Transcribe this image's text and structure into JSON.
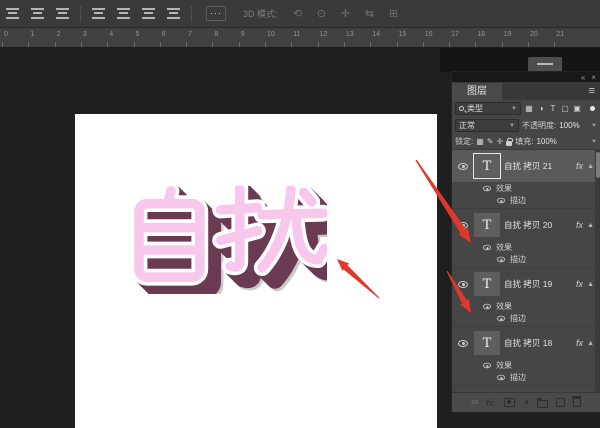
{
  "options_bar": {
    "align_icons_group1": [
      "align-top-edges-icon",
      "align-vertical-centers-icon",
      "align-bottom-edges-icon"
    ],
    "align_icons_group2": [
      "distribute-top-icon",
      "distribute-vertical-centers-icon",
      "distribute-bottom-icon",
      "distribute-spacing-icon"
    ],
    "more_label": "···",
    "mode_label": "3D 模式:",
    "mode_icons": [
      "3d-rotate-icon",
      "3d-roll-icon",
      "3d-drag-icon",
      "3d-slide-icon",
      "3d-scale-icon"
    ]
  },
  "ruler": {
    "numbers": [
      "0",
      "1",
      "2",
      "3",
      "4",
      "5",
      "6",
      "7",
      "8",
      "9",
      "10",
      "11",
      "12",
      "13",
      "14",
      "15",
      "16",
      "17",
      "18",
      "19",
      "20",
      "21"
    ]
  },
  "canvas": {
    "text": "自扰",
    "style": {
      "face_color": "#f7c7ec",
      "outline_color": "#ffffff",
      "extrude_color": "#6b3a53",
      "shadow_color": "#c9c9c9"
    }
  },
  "annotations": {
    "arrow_color": "#e0382b"
  },
  "panel": {
    "titlebar": {
      "collapse_icon": "«",
      "close_icon": "×"
    },
    "tab_label": "图层",
    "menu_icon": "≡",
    "filter": {
      "search_label": "类型",
      "icons": [
        "pixel-filter-icon",
        "adjustment-filter-icon",
        "type-filter-icon",
        "shape-filter-icon",
        "smart-object-filter-icon"
      ]
    },
    "blend_mode": "正常",
    "opacity_label": "不透明度:",
    "opacity_value": "100%",
    "lock_label": "锁定:",
    "lock_icons": [
      "lock-transparency-icon",
      "lock-pixels-icon",
      "lock-position-icon",
      "lock-all-icon"
    ],
    "fill_label": "填充:",
    "fill_value": "100%",
    "layers": [
      {
        "name": "自扰 拷贝 21",
        "thumb": "T",
        "selected": true,
        "fx_label": "fx",
        "effects": [
          "效果",
          "描边"
        ]
      },
      {
        "name": "自扰 拷贝 20",
        "thumb": "T",
        "selected": false,
        "fx_label": "fx",
        "effects": [
          "效果",
          "描边"
        ]
      },
      {
        "name": "自扰 拷贝 19",
        "thumb": "T",
        "selected": false,
        "fx_label": "fx",
        "effects": [
          "效果",
          "描边"
        ]
      },
      {
        "name": "自扰 拷贝 18",
        "thumb": "T",
        "selected": false,
        "fx_label": "fx",
        "effects": [
          "效果",
          "描边"
        ]
      }
    ],
    "footer_icons": [
      "link-icon",
      "fx-icon",
      "layer-mask-icon",
      "adjustment-icon",
      "group-folder-icon",
      "new-layer-icon",
      "delete-layer-icon"
    ]
  }
}
